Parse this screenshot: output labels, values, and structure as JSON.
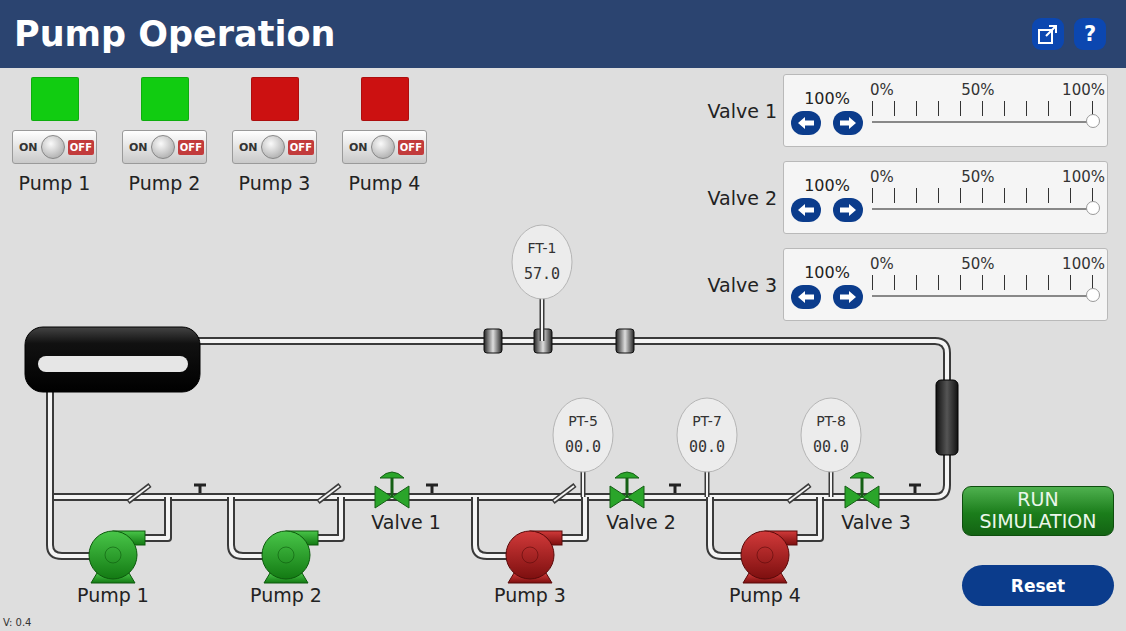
{
  "header": {
    "title": "Pump Operation",
    "help": "?"
  },
  "switch_labels": {
    "on": "ON",
    "off": "OFF"
  },
  "pumps": [
    {
      "label": "Pump 1",
      "on": true,
      "color": "#11cc11"
    },
    {
      "label": "Pump 2",
      "on": true,
      "color": "#11cc11"
    },
    {
      "label": "Pump 3",
      "on": false,
      "color": "#cc1111"
    },
    {
      "label": "Pump 4",
      "on": false,
      "color": "#cc1111"
    }
  ],
  "valves": [
    {
      "label": "Valve 1",
      "reading": "100%",
      "level": 1,
      "ticks": [
        "0%",
        "50%",
        "100%"
      ]
    },
    {
      "label": "Valve 2",
      "reading": "100%",
      "level": 1,
      "ticks": [
        "0%",
        "50%",
        "100%"
      ]
    },
    {
      "label": "Valve 3",
      "reading": "100%",
      "level": 1,
      "ticks": [
        "0%",
        "50%",
        "100%"
      ]
    }
  ],
  "instruments": [
    {
      "tag": "FT-1",
      "value": "57.0"
    },
    {
      "tag": "PT-5",
      "value": "00.0"
    },
    {
      "tag": "PT-7",
      "value": "00.0"
    },
    {
      "tag": "PT-8",
      "value": "00.0"
    }
  ],
  "buttons": {
    "run": "RUN SIMULATION",
    "reset": "Reset"
  },
  "version": "V: 0.4"
}
